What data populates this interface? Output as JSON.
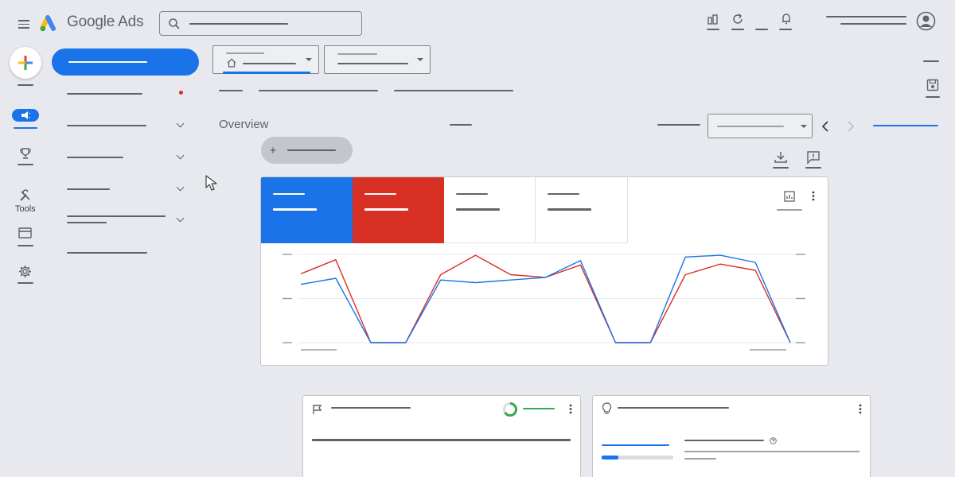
{
  "app": {
    "title": "Google Ads",
    "colors": {
      "accent": "#1a73e8",
      "red": "#d93025",
      "green": "#34a853",
      "background": "#e8e9ee"
    }
  },
  "top_bar": {
    "icons": [
      "menu-icon",
      "google-ads-logo",
      "search-icon",
      "reports-icon",
      "refresh-icon",
      "notifications-icon",
      "account-avatar-icon"
    ]
  },
  "left_rail": {
    "items": [
      {
        "name": "create",
        "icon": "plus-icon"
      },
      {
        "name": "campaigns",
        "icon": "megaphone-icon"
      },
      {
        "name": "goals",
        "icon": "trophy-icon"
      },
      {
        "name": "tools",
        "icon": "wrench-icon",
        "label": "Tools"
      },
      {
        "name": "billing",
        "icon": "credit-card-icon"
      },
      {
        "name": "admin",
        "icon": "gear-icon"
      }
    ]
  },
  "main": {
    "title": "Overview",
    "tiles": [
      {
        "color": "#1a73e8"
      },
      {
        "color": "#d93025"
      },
      {
        "color": "#ffffff"
      },
      {
        "color": "#ffffff"
      }
    ]
  },
  "chart_data": {
    "type": "line",
    "x": [
      1,
      2,
      3,
      4,
      5,
      6,
      7,
      8,
      9,
      10,
      11,
      12,
      13,
      14,
      15
    ],
    "series": [
      {
        "color": "#d93025",
        "values": [
          0.78,
          0.94,
          0.0,
          0.0,
          0.77,
          0.99,
          0.77,
          0.74,
          0.88,
          0.0,
          0.0,
          0.77,
          0.89,
          0.82,
          0.0
        ]
      },
      {
        "color": "#1a73e8",
        "values": [
          0.66,
          0.73,
          0.0,
          0.0,
          0.71,
          0.68,
          0.71,
          0.74,
          0.93,
          0.0,
          0.0,
          0.97,
          0.99,
          0.91,
          0.0
        ]
      }
    ],
    "ylim": [
      0,
      1
    ],
    "grid": true,
    "legend": "none"
  }
}
